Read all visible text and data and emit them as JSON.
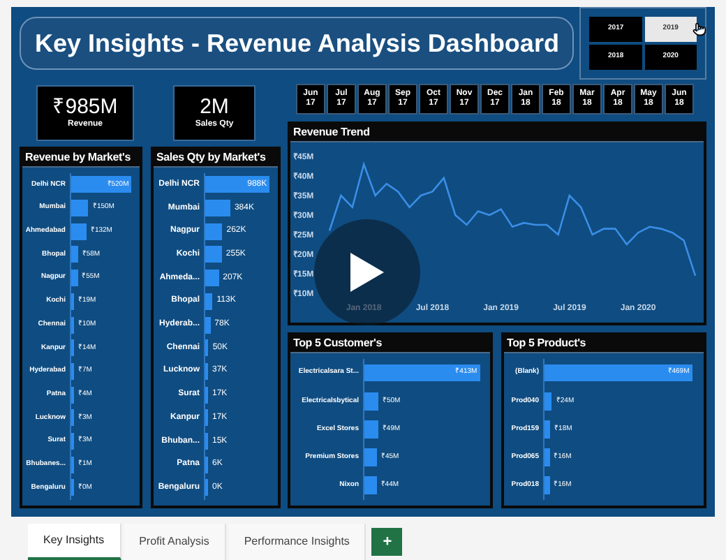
{
  "title": "Key Insights - Revenue Analysis Dashboard",
  "year_slicer": [
    {
      "label": "2017",
      "selected": false
    },
    {
      "label": "2019",
      "selected": true
    },
    {
      "label": "2018",
      "selected": false
    },
    {
      "label": "2020",
      "selected": false
    }
  ],
  "kpis": [
    {
      "value": "₹985M",
      "label": "Revenue"
    },
    {
      "value": "2M",
      "label": "Sales Qty"
    }
  ],
  "month_slicer": [
    {
      "month": "Jun",
      "year": "17"
    },
    {
      "month": "Jul",
      "year": "17"
    },
    {
      "month": "Aug",
      "year": "17"
    },
    {
      "month": "Sep",
      "year": "17"
    },
    {
      "month": "Oct",
      "year": "17"
    },
    {
      "month": "Nov",
      "year": "17"
    },
    {
      "month": "Dec",
      "year": "17"
    },
    {
      "month": "Jan",
      "year": "18"
    },
    {
      "month": "Feb",
      "year": "18"
    },
    {
      "month": "Mar",
      "year": "18"
    },
    {
      "month": "Apr",
      "year": "18"
    },
    {
      "month": "May",
      "year": "18"
    },
    {
      "month": "Jun",
      "year": "18"
    }
  ],
  "revenue_by_market": {
    "title": "Revenue by Market's",
    "chart_data": {
      "type": "bar",
      "orientation": "horizontal",
      "categories": [
        "Delhi NCR",
        "Mumbai",
        "Ahmedabad",
        "Bhopal",
        "Nagpur",
        "Kochi",
        "Chennai",
        "Kanpur",
        "Hyderabad",
        "Patna",
        "Lucknow",
        "Surat",
        "Bhubanes...",
        "Bengaluru"
      ],
      "values": [
        520,
        150,
        132,
        58,
        55,
        19,
        10,
        14,
        7,
        4,
        3,
        3,
        1,
        0
      ],
      "value_labels": [
        "₹520M",
        "₹150M",
        "₹132M",
        "₹58M",
        "₹55M",
        "₹19M",
        "₹10M",
        "₹14M",
        "₹7M",
        "₹4M",
        "₹3M",
        "₹3M",
        "₹1M",
        "₹0M"
      ]
    }
  },
  "sales_qty_by_market": {
    "title": "Sales Qty by Market's",
    "chart_data": {
      "type": "bar",
      "orientation": "horizontal",
      "categories": [
        "Delhi NCR",
        "Mumbai",
        "Nagpur",
        "Kochi",
        "Ahmeda...",
        "Bhopal",
        "Hyderab...",
        "Chennai",
        "Lucknow",
        "Surat",
        "Kanpur",
        "Bhuban...",
        "Patna",
        "Bengaluru"
      ],
      "values": [
        988,
        384,
        262,
        255,
        207,
        113,
        78,
        50,
        37,
        17,
        17,
        15,
        6,
        0
      ],
      "value_labels": [
        "988K",
        "384K",
        "262K",
        "255K",
        "207K",
        "113K",
        "78K",
        "50K",
        "37K",
        "17K",
        "17K",
        "15K",
        "6K",
        "0K"
      ]
    }
  },
  "revenue_trend": {
    "title": "Revenue Trend",
    "chart_data": {
      "type": "line",
      "categories": [
        null,
        null,
        null,
        "Jan 2018",
        null,
        null,
        null,
        null,
        null,
        "Jul 2018",
        null,
        null,
        null,
        null,
        null,
        "Jan 2019",
        null,
        null,
        null,
        null,
        null,
        "Jul 2019",
        null,
        null,
        null,
        null,
        null,
        "Jan 2020",
        null,
        null,
        null,
        null,
        null
      ],
      "series": [
        {
          "color": "#3a8ee6",
          "values": [
            26,
            35,
            32,
            43,
            35,
            38,
            36,
            32,
            35,
            36,
            39.5,
            30,
            27.5,
            31,
            30,
            31.5,
            27,
            28,
            27.5,
            27.5,
            25,
            35,
            32,
            25,
            26.5,
            26.5,
            22.5,
            25.5,
            27,
            26.5,
            25.5,
            23.5,
            14.5
          ]
        }
      ],
      "ylim": [
        10,
        45
      ],
      "yticks": [
        {
          "value": 10,
          "label": "₹10M"
        },
        {
          "value": 15,
          "label": "₹15M"
        },
        {
          "value": 20,
          "label": "₹20M"
        },
        {
          "value": 25,
          "label": "₹25M"
        },
        {
          "value": 30,
          "label": "₹30M"
        },
        {
          "value": 35,
          "label": "₹35M"
        },
        {
          "value": 40,
          "label": "₹40M"
        },
        {
          "value": 45,
          "label": "₹45M"
        }
      ]
    }
  },
  "top_customers": {
    "title": "Top 5 Customer's",
    "chart_data": {
      "type": "bar",
      "orientation": "horizontal",
      "categories": [
        "Electricalsara St...",
        "Electricalsbytical",
        "Excel Stores",
        "Premium Stores",
        "Nixon"
      ],
      "values": [
        413,
        50,
        49,
        45,
        44
      ],
      "value_labels": [
        "₹413M",
        "₹50M",
        "₹49M",
        "₹45M",
        "₹44M"
      ]
    }
  },
  "top_products": {
    "title": "Top 5 Product's",
    "chart_data": {
      "type": "bar",
      "orientation": "horizontal",
      "categories": [
        "(Blank)",
        "Prod040",
        "Prod159",
        "Prod065",
        "Prod018"
      ],
      "values": [
        469,
        24,
        18,
        16,
        16
      ],
      "value_labels": [
        "₹469M",
        "₹24M",
        "₹18M",
        "₹16M",
        "₹16M"
      ]
    }
  },
  "sheet_tabs": [
    {
      "label": "Key Insights",
      "selected": true
    },
    {
      "label": "Profit Analysis",
      "selected": false
    },
    {
      "label": "Performance Insights",
      "selected": false
    }
  ],
  "add_tab": "+"
}
